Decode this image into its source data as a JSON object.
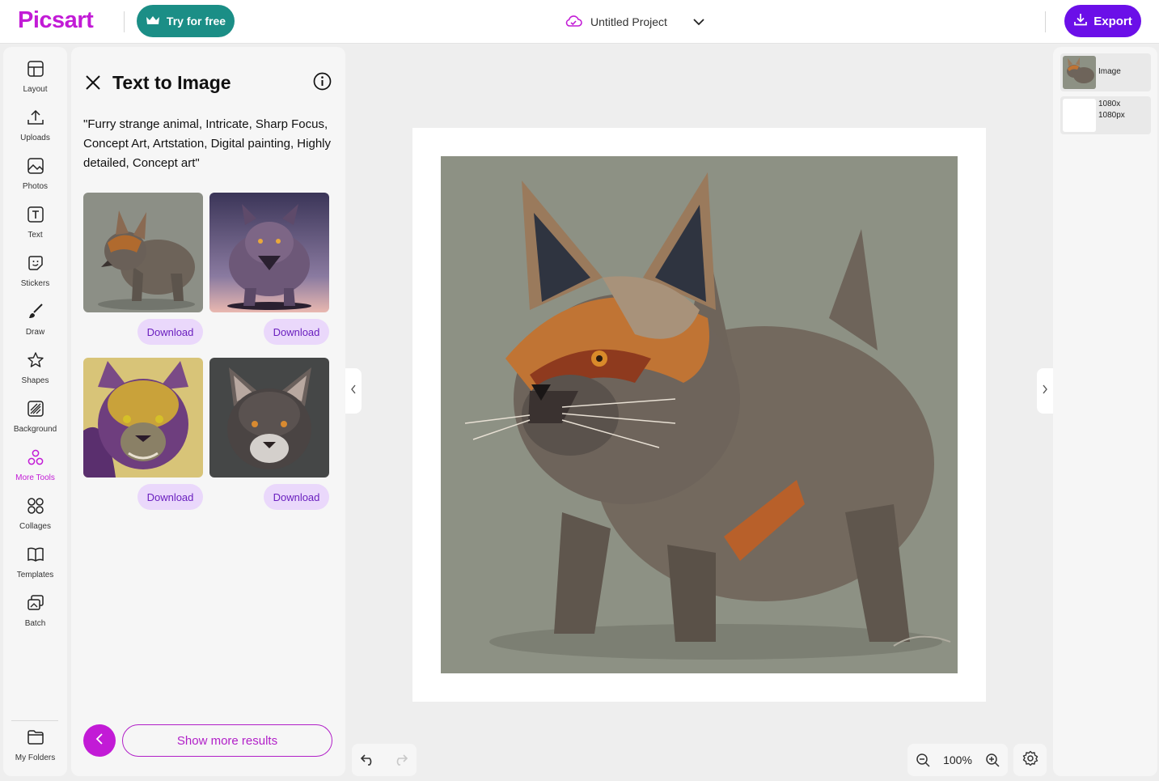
{
  "header": {
    "logo": "Picsart",
    "try_label": "Try for free",
    "project_name": "Untitled Project",
    "export_label": "Export"
  },
  "rail": {
    "items": [
      {
        "label": "Layout",
        "icon": "layout-icon"
      },
      {
        "label": "Uploads",
        "icon": "upload-icon"
      },
      {
        "label": "Photos",
        "icon": "photo-icon"
      },
      {
        "label": "Text",
        "icon": "text-icon"
      },
      {
        "label": "Stickers",
        "icon": "sticker-icon"
      },
      {
        "label": "Draw",
        "icon": "brush-icon"
      },
      {
        "label": "Shapes",
        "icon": "star-icon"
      },
      {
        "label": "Background",
        "icon": "background-icon"
      },
      {
        "label": "More Tools",
        "icon": "more-tools-icon"
      },
      {
        "label": "Collages",
        "icon": "collage-icon"
      },
      {
        "label": "Templates",
        "icon": "templates-icon"
      },
      {
        "label": "Batch",
        "icon": "batch-icon"
      }
    ],
    "folders_label": "My Folders",
    "active_color": "#c21bd6"
  },
  "panel": {
    "title": "Text to Image",
    "prompt": "\"Furry strange animal, Intricate, Sharp Focus, Concept Art, Artstation, Digital painting, Highly detailed, Concept art\"",
    "download_label": "Download",
    "show_more_label": "Show more results"
  },
  "canvas": {
    "zoom": "100%"
  },
  "layers": {
    "image_label": "Image",
    "size_label_1": "1080x",
    "size_label_2": "1080px"
  },
  "colors": {
    "brand": "#c21bd6",
    "try_bg": "#1b8e86",
    "export_bg": "#6b0fe8",
    "download_bg": "#ead8fb"
  }
}
